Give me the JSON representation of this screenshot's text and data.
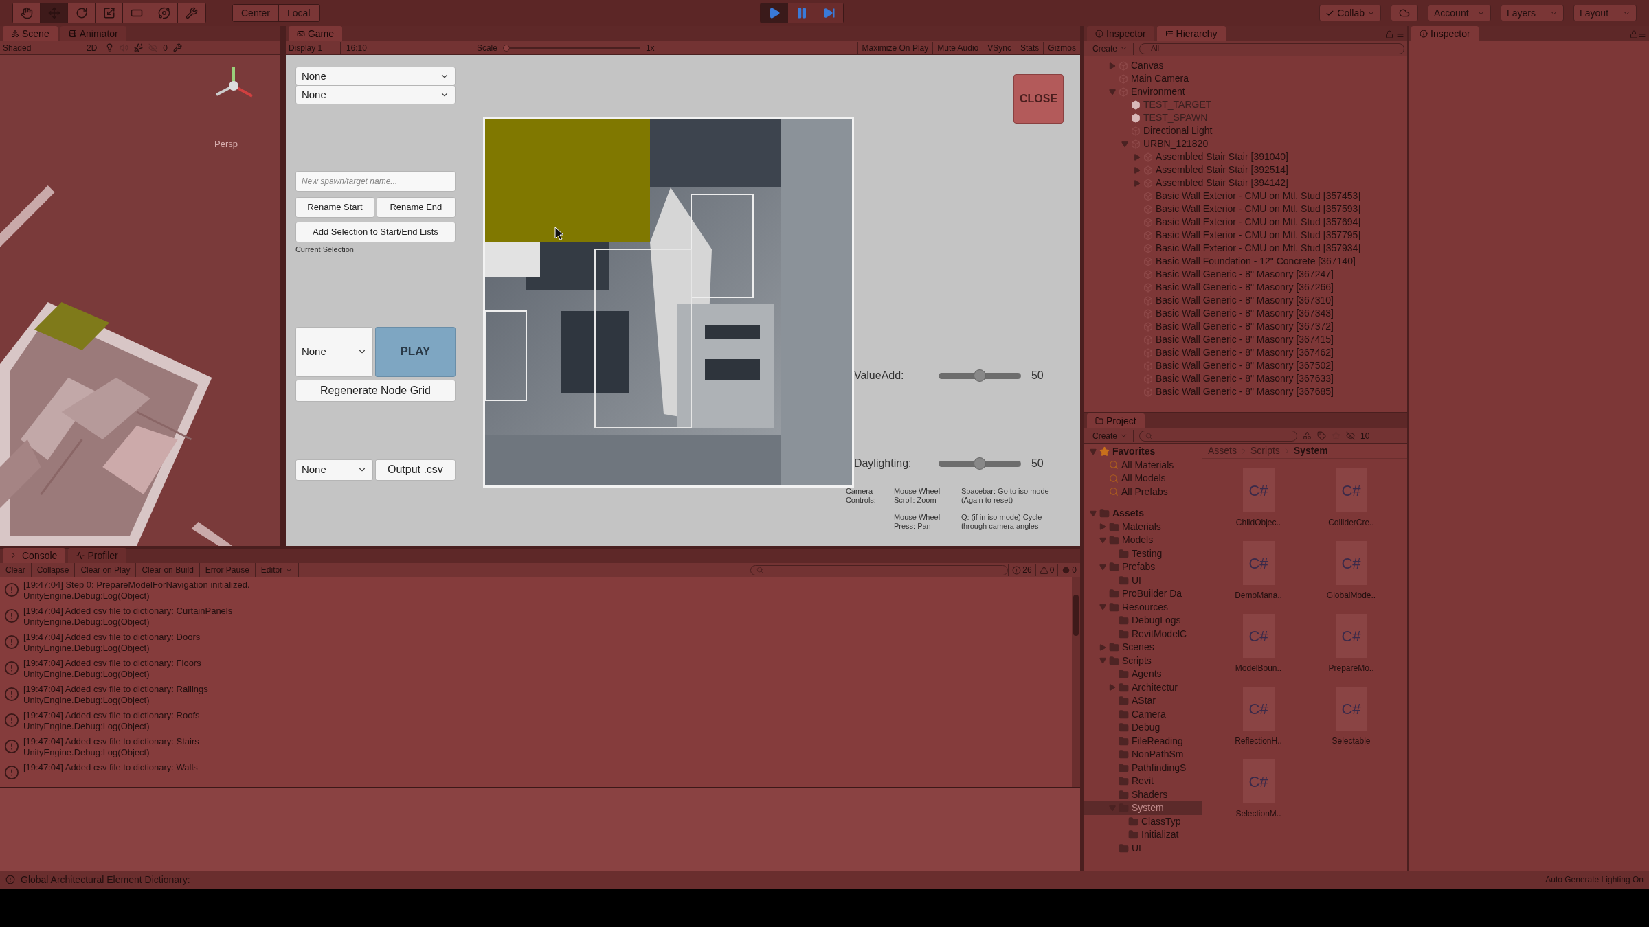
{
  "toolbar": {
    "tools": [
      {
        "kind": "hand",
        "selected": false
      },
      {
        "kind": "move",
        "selected": true
      },
      {
        "kind": "rotate",
        "selected": false
      },
      {
        "kind": "scale",
        "selected": false
      },
      {
        "kind": "rect",
        "selected": false
      },
      {
        "kind": "transform",
        "selected": false
      },
      {
        "kind": "custom",
        "selected": false
      }
    ],
    "pivot_buttons": [
      "Center",
      "Local"
    ],
    "play_controls": [
      {
        "kind": "play",
        "selected": true
      },
      {
        "kind": "pause",
        "selected": false
      },
      {
        "kind": "step",
        "selected": false
      }
    ],
    "collab": "Collab",
    "menus": [
      "Account",
      "Layers",
      "Layout"
    ]
  },
  "scene_panel": {
    "tabs": [
      {
        "label": "Scene",
        "selected": true
      },
      {
        "label": "Animator",
        "selected": false
      }
    ],
    "shading": "Shaded",
    "mode_2d": "2D",
    "hidden_count": "0",
    "gizmo_label": "Persp"
  },
  "game_panel": {
    "tab": "Game",
    "display": "Display 1",
    "aspect": "16:10",
    "scale_label": "Scale",
    "scale_slider": {
      "level": 0
    },
    "scale_value": "1x",
    "buttons": [
      "Maximize On Play",
      "Mute Audio",
      "VSync",
      "Stats",
      "Gizmos"
    ],
    "ui": {
      "top_dropdowns": [
        "None",
        "None"
      ],
      "name_field": {
        "placeholder": "New spawn/target name..."
      },
      "rename_buttons": [
        "Rename Start",
        "Rename End"
      ],
      "add_button": "Add Selection to Start/End Lists",
      "selection_label": "Current Selection",
      "play_dropdown": "None",
      "play_button": "PLAY",
      "regenerate_button": "Regenerate Node Grid",
      "output_dropdown": "None",
      "output_button": "Output .csv",
      "close_button": "CLOSE",
      "sliders": [
        {
          "label": "ValueAdd:",
          "level": 0.5,
          "reading": "50"
        },
        {
          "label": "Daylighting:",
          "level": 0.5,
          "reading": "50"
        }
      ],
      "help_title": "Camera Controls:",
      "help": [
        "Mouse Wheel Scroll: Zoom",
        "Spacebar: Go to iso mode (Again to reset)",
        "Mouse Wheel Press: Pan",
        "Q: (if in iso mode) Cycle through camera angles"
      ]
    }
  },
  "hierarchy": {
    "tabs": [
      {
        "label": "Inspector",
        "selected": false
      },
      {
        "label": "Hierarchy",
        "selected": true
      }
    ],
    "create": "Create",
    "search": {
      "placeholder": "All"
    },
    "items": [
      {
        "label": "Canvas",
        "kind": "object",
        "expanded": false
      },
      {
        "label": "Main Camera",
        "kind": "object"
      },
      {
        "label": "Environment",
        "kind": "object",
        "expanded": true,
        "children": [
          {
            "label": "TEST_TARGET",
            "kind": "marker"
          },
          {
            "label": "TEST_SPAWN",
            "kind": "marker"
          },
          {
            "label": "Directional Light",
            "kind": "object"
          },
          {
            "label": "URBN_121820",
            "kind": "object",
            "expanded": true,
            "children": [
              {
                "label": "Assembled Stair Stair [391040]",
                "kind": "object",
                "expanded": false
              },
              {
                "label": "Assembled Stair Stair [392514]",
                "kind": "object",
                "expanded": false
              },
              {
                "label": "Assembled Stair Stair [394142]",
                "kind": "object",
                "expanded": false
              },
              {
                "label": "Basic Wall Exterior - CMU on Mtl. Stud [357453]",
                "kind": "object"
              },
              {
                "label": "Basic Wall Exterior - CMU on Mtl. Stud [357593]",
                "kind": "object"
              },
              {
                "label": "Basic Wall Exterior - CMU on Mtl. Stud [357694]",
                "kind": "object"
              },
              {
                "label": "Basic Wall Exterior - CMU on Mtl. Stud [357795]",
                "kind": "object"
              },
              {
                "label": "Basic Wall Exterior - CMU on Mtl. Stud [357934]",
                "kind": "object"
              },
              {
                "label": "Basic Wall Foundation - 12\" Concrete [367140]",
                "kind": "object"
              },
              {
                "label": "Basic Wall Generic - 8\" Masonry [367247]",
                "kind": "object"
              },
              {
                "label": "Basic Wall Generic - 8\" Masonry [367266]",
                "kind": "object"
              },
              {
                "label": "Basic Wall Generic - 8\" Masonry [367310]",
                "kind": "object"
              },
              {
                "label": "Basic Wall Generic - 8\" Masonry [367343]",
                "kind": "object"
              },
              {
                "label": "Basic Wall Generic - 8\" Masonry [367372]",
                "kind": "object"
              },
              {
                "label": "Basic Wall Generic - 8\" Masonry [367415]",
                "kind": "object"
              },
              {
                "label": "Basic Wall Generic - 8\" Masonry [367462]",
                "kind": "object"
              },
              {
                "label": "Basic Wall Generic - 8\" Masonry [367502]",
                "kind": "object"
              },
              {
                "label": "Basic Wall Generic - 8\" Masonry [367633]",
                "kind": "object"
              },
              {
                "label": "Basic Wall Generic - 8\" Masonry [367685]",
                "kind": "object"
              }
            ]
          }
        ]
      }
    ]
  },
  "project": {
    "tab": "Project",
    "create": "Create",
    "hidden_count": "10",
    "favorites": {
      "label": "Favorites",
      "expanded": true,
      "children": [
        {
          "label": "All Materials"
        },
        {
          "label": "All Models"
        },
        {
          "label": "All Prefabs"
        }
      ]
    },
    "assets": {
      "label": "Assets",
      "expanded": true,
      "children": [
        {
          "label": "Materials",
          "expanded": false,
          "selected": false
        },
        {
          "label": "Models",
          "expanded": true,
          "selected": false,
          "children": [
            {
              "label": "Testing",
              "selected": false
            }
          ]
        },
        {
          "label": "Prefabs",
          "expanded": true,
          "selected": false,
          "children": [
            {
              "label": "UI",
              "selected": false
            }
          ]
        },
        {
          "label": "ProBuilder Da",
          "selected": false
        },
        {
          "label": "Resources",
          "expanded": true,
          "selected": false,
          "children": [
            {
              "label": "DebugLogs",
              "selected": false
            },
            {
              "label": "RevitModelC",
              "selected": false
            }
          ]
        },
        {
          "label": "Scenes",
          "expanded": false,
          "selected": false
        },
        {
          "label": "Scripts",
          "expanded": true,
          "selected": false,
          "children": [
            {
              "label": "Agents",
              "selected": false
            },
            {
              "label": "Architectur",
              "expanded": false,
              "selected": false
            },
            {
              "label": "AStar",
              "selected": false
            },
            {
              "label": "Camera",
              "selected": false
            },
            {
              "label": "Debug",
              "selected": false
            },
            {
              "label": "FileReading",
              "selected": false
            },
            {
              "label": "NonPathSm",
              "selected": false
            },
            {
              "label": "PathfindingS",
              "selected": false
            },
            {
              "label": "Revit",
              "selected": false
            },
            {
              "label": "Shaders",
              "selected": false
            },
            {
              "label": "System",
              "expanded": true,
              "selected": true,
              "children": [
                {
                  "label": "ClassTyp",
                  "selected": false
                },
                {
                  "label": "Initializat",
                  "selected": false
                }
              ]
            },
            {
              "label": "UI",
              "selected": false
            }
          ]
        }
      ]
    },
    "breadcrumb": [
      "Assets",
      "Scripts",
      "System"
    ],
    "files": [
      {
        "icon_text": "C#",
        "name": "ChildObjec.."
      },
      {
        "icon_text": "C#",
        "name": "ColliderCre.."
      },
      {
        "icon_text": "C#",
        "name": "DemoMana.."
      },
      {
        "icon_text": "C#",
        "name": "GlobalMode.."
      },
      {
        "icon_text": "C#",
        "name": "ModelBoun.."
      },
      {
        "icon_text": "C#",
        "name": "PrepareMo.."
      },
      {
        "icon_text": "C#",
        "name": "ReflectionH.."
      },
      {
        "icon_text": "C#",
        "name": "Selectable"
      },
      {
        "icon_text": "C#",
        "name": "SelectionM.."
      }
    ]
  },
  "inspector": {
    "tab": "Inspector"
  },
  "console": {
    "tabs": [
      {
        "label": "Console",
        "selected": true
      },
      {
        "label": "Profiler",
        "selected": false
      }
    ],
    "buttons": [
      "Clear",
      "Collapse",
      "Clear on Play",
      "Clear on Build",
      "Error Pause",
      "Editor"
    ],
    "counts": [
      {
        "kind": "info",
        "count": "26"
      },
      {
        "kind": "warning",
        "count": "0"
      },
      {
        "kind": "error",
        "count": "0"
      }
    ],
    "entries": [
      {
        "message": "[19:47:04] Step 0: PrepareModelForNavigation initialized.",
        "trace": "UnityEngine.Debug:Log(Object)"
      },
      {
        "message": "[19:47:04] Added csv file to dictionary: CurtainPanels",
        "trace": "UnityEngine.Debug:Log(Object)"
      },
      {
        "message": "[19:47:04] Added csv file to dictionary: Doors",
        "trace": "UnityEngine.Debug:Log(Object)"
      },
      {
        "message": "[19:47:04] Added csv file to dictionary: Floors",
        "trace": "UnityEngine.Debug:Log(Object)"
      },
      {
        "message": "[19:47:04] Added csv file to dictionary: Railings",
        "trace": "UnityEngine.Debug:Log(Object)"
      },
      {
        "message": "[19:47:04] Added csv file to dictionary: Roofs",
        "trace": "UnityEngine.Debug:Log(Object)"
      },
      {
        "message": "[19:47:04] Added csv file to dictionary: Stairs",
        "trace": "UnityEngine.Debug:Log(Object)"
      },
      {
        "message": "[19:47:04] Added csv file to dictionary: Walls"
      }
    ]
  },
  "status_bar": {
    "message": "Global Architectural Element Dictionary:",
    "right": "Auto Generate Lighting On"
  }
}
